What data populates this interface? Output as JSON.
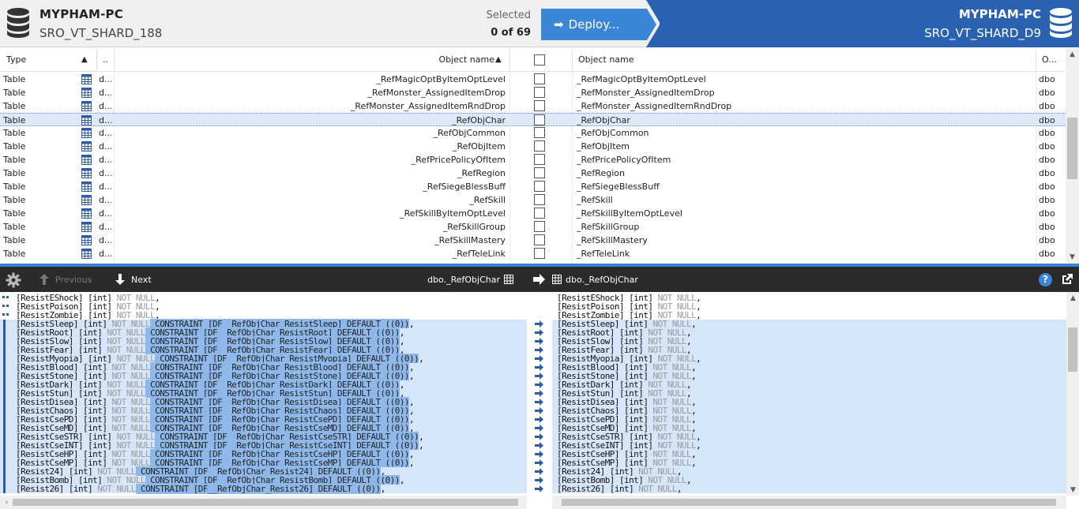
{
  "header": {
    "source": {
      "server": "MYPHAM-PC",
      "database": "SRO_VT_SHARD_188"
    },
    "selected_label": "Selected",
    "selected_count": "0 of 69",
    "deploy_label": "Deploy...",
    "target": {
      "server": "MYPHAM-PC",
      "database": "SRO_VT_SHARD_D9"
    }
  },
  "grid": {
    "columns": {
      "type": "Type",
      "dots": "..",
      "object_name_left": "Object name",
      "object_name_right": "Object name",
      "owner": "O..."
    },
    "rows": [
      {
        "type": "Table",
        "dots": "d...",
        "left": "_RefMagicOptByItemOptLevel",
        "right": "_RefMagicOptByItemOptLevel",
        "owner": "dbo"
      },
      {
        "type": "Table",
        "dots": "d...",
        "left": "_RefMonster_AssignedItemDrop",
        "right": "_RefMonster_AssignedItemDrop",
        "owner": "dbo"
      },
      {
        "type": "Table",
        "dots": "d...",
        "left": "_RefMonster_AssignedItemRndDrop",
        "right": "_RefMonster_AssignedItemRndDrop",
        "owner": "dbo"
      },
      {
        "type": "Table",
        "dots": "d...",
        "left": "_RefObjChar",
        "right": "_RefObjChar",
        "owner": "dbo",
        "selected": true
      },
      {
        "type": "Table",
        "dots": "d...",
        "left": "_RefObjCommon",
        "right": "_RefObjCommon",
        "owner": "dbo"
      },
      {
        "type": "Table",
        "dots": "d...",
        "left": "_RefObjItem",
        "right": "_RefObjItem",
        "owner": "dbo"
      },
      {
        "type": "Table",
        "dots": "d...",
        "left": "_RefPricePolicyOfItem",
        "right": "_RefPricePolicyOfItem",
        "owner": "dbo"
      },
      {
        "type": "Table",
        "dots": "d...",
        "left": "_RefRegion",
        "right": "_RefRegion",
        "owner": "dbo"
      },
      {
        "type": "Table",
        "dots": "d...",
        "left": "_RefSiegeBlessBuff",
        "right": "_RefSiegeBlessBuff",
        "owner": "dbo"
      },
      {
        "type": "Table",
        "dots": "d...",
        "left": "_RefSkill",
        "right": "_RefSkill",
        "owner": "dbo"
      },
      {
        "type": "Table",
        "dots": "d...",
        "left": "_RefSkillByItemOptLevel",
        "right": "_RefSkillByItemOptLevel",
        "owner": "dbo"
      },
      {
        "type": "Table",
        "dots": "d...",
        "left": "_RefSkillGroup",
        "right": "_RefSkillGroup",
        "owner": "dbo"
      },
      {
        "type": "Table",
        "dots": "d...",
        "left": "_RefSkillMastery",
        "right": "_RefSkillMastery",
        "owner": "dbo"
      },
      {
        "type": "Table",
        "dots": "d...",
        "left": "_RefTeleLink",
        "right": "_RefTeleLink",
        "owner": "dbo"
      }
    ]
  },
  "diff_toolbar": {
    "previous_label": "Previous",
    "next_label": "Next",
    "left_object": "dbo._RefObjChar",
    "right_object": "dbo._RefObjChar",
    "help_label": "?"
  },
  "code": {
    "null_word": "NOT NULL",
    "lines": [
      {
        "col": "[ResistEShock]",
        "dtype": "[int]",
        "changed": false
      },
      {
        "col": "[ResistPoison]",
        "dtype": "[int]",
        "changed": false
      },
      {
        "col": "[ResistZombie]",
        "dtype": "[int]",
        "changed": false
      },
      {
        "col": "[ResistSleep]",
        "dtype": "[int]",
        "changed": true,
        "constraint": "CONSTRAINT [DF__RefObjChar_ResistSleep] DEFAULT ((0))"
      },
      {
        "col": "[ResistRoot]",
        "dtype": "[int]",
        "changed": true,
        "constraint": "CONSTRAINT [DF__RefObjChar_ResistRoot] DEFAULT ((0))"
      },
      {
        "col": "[ResistSlow]",
        "dtype": "[int]",
        "changed": true,
        "constraint": "CONSTRAINT [DF__RefObjChar_ResistSlow] DEFAULT ((0))"
      },
      {
        "col": "[ResistFear]",
        "dtype": "[int]",
        "changed": true,
        "constraint": "CONSTRAINT [DF__RefObjChar_ResistFear] DEFAULT ((0))"
      },
      {
        "col": "[ResistMyopia]",
        "dtype": "[int]",
        "changed": true,
        "constraint": "CONSTRAINT [DF__RefObjChar_ResistMyopia] DEFAULT ((0))"
      },
      {
        "col": "[ResistBlood]",
        "dtype": "[int]",
        "changed": true,
        "constraint": "CONSTRAINT [DF__RefObjChar_ResistBlood] DEFAULT ((0))"
      },
      {
        "col": "[ResistStone]",
        "dtype": "[int]",
        "changed": true,
        "constraint": "CONSTRAINT [DF__RefObjChar_ResistStone] DEFAULT ((0))"
      },
      {
        "col": "[ResistDark]",
        "dtype": "[int]",
        "changed": true,
        "constraint": "CONSTRAINT [DF__RefObjChar_ResistDark] DEFAULT ((0))"
      },
      {
        "col": "[ResistStun]",
        "dtype": "[int]",
        "changed": true,
        "constraint": "CONSTRAINT [DF__RefObjChar_ResistStun] DEFAULT ((0))"
      },
      {
        "col": "[ResistDisea]",
        "dtype": "[int]",
        "changed": true,
        "constraint": "CONSTRAINT [DF__RefObjChar_ResistDisea] DEFAULT ((0))"
      },
      {
        "col": "[ResistChaos]",
        "dtype": "[int]",
        "changed": true,
        "constraint": "CONSTRAINT [DF__RefObjChar_ResistChaos] DEFAULT ((0))"
      },
      {
        "col": "[ResistCsePD]",
        "dtype": "[int]",
        "changed": true,
        "constraint": "CONSTRAINT [DF__RefObjChar_ResistCsePD] DEFAULT ((0))"
      },
      {
        "col": "[ResistCseMD]",
        "dtype": "[int]",
        "changed": true,
        "constraint": "CONSTRAINT [DF__RefObjChar_ResistCseMD] DEFAULT ((0))"
      },
      {
        "col": "[ResistCseSTR]",
        "dtype": "[int]",
        "changed": true,
        "constraint": "CONSTRAINT [DF__RefObjChar_ResistCseSTR] DEFAULT ((0))"
      },
      {
        "col": "[ResistCseINT]",
        "dtype": "[int]",
        "changed": true,
        "constraint": "CONSTRAINT [DF__RefObjChar_ResistCseINT] DEFAULT ((0))"
      },
      {
        "col": "[ResistCseHP]",
        "dtype": "[int]",
        "changed": true,
        "constraint": "CONSTRAINT [DF__RefObjChar_ResistCseHP] DEFAULT ((0))"
      },
      {
        "col": "[ResistCseMP]",
        "dtype": "[int]",
        "changed": true,
        "constraint": "CONSTRAINT [DF__RefObjChar_ResistCseMP] DEFAULT ((0))"
      },
      {
        "col": "[Resist24]",
        "dtype": "[int]",
        "changed": true,
        "constraint": "CONSTRAINT [DF__RefObjChar_Resist24] DEFAULT ((0))"
      },
      {
        "col": "[ResistBomb]",
        "dtype": "[int]",
        "changed": true,
        "constraint": "CONSTRAINT [DF__RefObjChar_ResistBomb] DEFAULT ((0))"
      },
      {
        "col": "[Resist26]",
        "dtype": "[int]",
        "changed": true,
        "constraint": "CONSTRAINT [DF__RefObjChar_Resist26] DEFAULT ((0))"
      }
    ]
  },
  "colors": {
    "deploy_button": "#3b86d7",
    "target_header": "#2a62b1",
    "split_bar": "#3b7fd4",
    "diff_toolbar": "#2b2b2b",
    "changed_line": "#d6e6fa",
    "changed_token": "#8fb8ea",
    "diff_marker": "#2c5ca8"
  },
  "icons": {
    "database": "database-icon",
    "table": "table-grid-icon",
    "settings": "gear-icon",
    "previous": "arrow-up-icon",
    "next": "arrow-down-icon",
    "compare": "arrow-right-icon",
    "help": "help-icon",
    "popout": "popout-icon"
  }
}
